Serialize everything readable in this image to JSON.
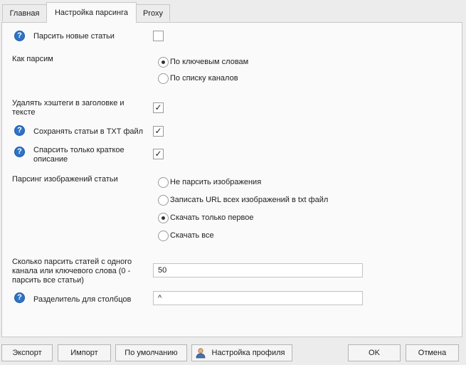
{
  "tabs": [
    {
      "label": "Главная",
      "active": false
    },
    {
      "label": "Настройка парсинга",
      "active": true
    },
    {
      "label": "Proxy",
      "active": false
    }
  ],
  "form": {
    "parse_new": {
      "label": "Парсить новые статьи",
      "checked": false
    },
    "how_parse": {
      "label": "Как парсим",
      "options": [
        {
          "label": "По ключевым словам",
          "selected": true
        },
        {
          "label": "По списку каналов",
          "selected": false
        }
      ]
    },
    "remove_hashtags": {
      "label_line1": "Удалять хэштеги в заголовке и",
      "label_line2": "тексте",
      "checked": true
    },
    "save_txt": {
      "label": "Сохранять статьи в TXT файл",
      "checked": true
    },
    "short_desc": {
      "label_line1": "Спарсить только краткое",
      "label_line2": "описание",
      "checked": true
    },
    "images": {
      "label": "Парсинг изображений статьи",
      "options": [
        {
          "label": "Не парсить изображения",
          "selected": false
        },
        {
          "label": "Записать URL всех изображений в txt файл",
          "selected": false
        },
        {
          "label": "Скачать только первое",
          "selected": true
        },
        {
          "label": "Скачать все",
          "selected": false
        }
      ]
    },
    "count": {
      "label_line1": "Сколько парсить статей с одного",
      "label_line2": "канала или ключевого слова (0 -",
      "label_line3": "парсить все статьи)",
      "value": "50"
    },
    "separator": {
      "label": "Разделитель для столбцов",
      "value": "^"
    }
  },
  "icons": {
    "help": "help-circle-icon",
    "help_glyph": "?",
    "check_glyph": "✓",
    "profile": "user-icon"
  },
  "buttons": {
    "export": "Экспорт",
    "import": "Импорт",
    "defaults": "По умолчанию",
    "profile": "Настройка профиля",
    "ok": "OK",
    "cancel": "Отмена"
  },
  "colors": {
    "help_icon": "#2f73c5",
    "panel": "#fafafa",
    "background": "#ececec"
  }
}
